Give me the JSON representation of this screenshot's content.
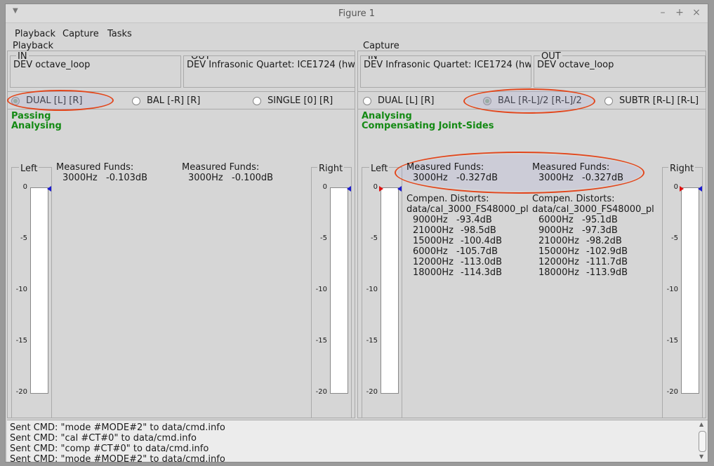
{
  "window": {
    "title": "Figure 1",
    "controls": [
      "–",
      "+",
      "×"
    ]
  },
  "menu": [
    "Playback",
    "Capture",
    "Tasks"
  ],
  "playback": {
    "title": "Playback",
    "in_label": "IN",
    "in_device": "DEV octave_loop",
    "out_label": "OUT",
    "out_device": "DEV Infrasonic Quartet: ICE1724 (hw:",
    "radios": [
      "DUAL [L] [R]",
      "BAL [-R] [R]",
      "SINGLE [0] [R]"
    ],
    "status": [
      "Passing",
      "Analysing"
    ],
    "left_label": "Left",
    "right_label": "Right",
    "funds_left": {
      "title": "Measured Funds:",
      "freq": "3000Hz",
      "value": "-0.103dB"
    },
    "funds_right": {
      "title": "Measured Funds:",
      "freq": "3000Hz",
      "value": "-0.100dB"
    }
  },
  "capture": {
    "title": "Capture",
    "in_label": "IN",
    "in_device": "DEV Infrasonic Quartet: ICE1724 (hw:",
    "out_label": "OUT",
    "out_device": "DEV octave_loop",
    "radios": [
      "DUAL [L] [R]",
      "BAL [R-L]/2 [R-L]/2",
      "SUBTR [R-L] [R-L]"
    ],
    "status": [
      "Analysing",
      "Compensating Joint-Sides"
    ],
    "left_label": "Left",
    "right_label": "Right",
    "funds_left": {
      "title": "Measured Funds:",
      "freq": "3000Hz",
      "value": "-0.327dB"
    },
    "funds_right": {
      "title": "Measured Funds:",
      "freq": "3000Hz",
      "value": "-0.327dB"
    },
    "distorts_left": {
      "title": "Compen. Distorts:",
      "file": "data/cal_3000_FS48000_pl",
      "rows": [
        [
          "9000Hz",
          "-93.4dB"
        ],
        [
          "21000Hz",
          "-98.5dB"
        ],
        [
          "15000Hz",
          "-100.4dB"
        ],
        [
          "6000Hz",
          "-105.7dB"
        ],
        [
          "12000Hz",
          "-113.0dB"
        ],
        [
          "18000Hz",
          "-114.3dB"
        ]
      ]
    },
    "distorts_right": {
      "title": "Compen. Distorts:",
      "file": "data/cal_3000_FS48000_pl",
      "rows": [
        [
          "6000Hz",
          "-95.1dB"
        ],
        [
          "9000Hz",
          "-97.3dB"
        ],
        [
          "21000Hz",
          "-98.2dB"
        ],
        [
          "15000Hz",
          "-102.9dB"
        ],
        [
          "12000Hz",
          "-111.7dB"
        ],
        [
          "18000Hz",
          "-113.9dB"
        ]
      ]
    }
  },
  "meter_ticks": [
    "0",
    "-5",
    "-10",
    "-15",
    "-20"
  ],
  "console": [
    "Sent CMD: \"mode #MODE#2\" to data/cmd.info",
    "Sent CMD: \"cal #CT#0\" to data/cmd.info",
    "Sent CMD: \"comp #CT#0\" to data/cmd.info",
    "Sent CMD: \"mode #MODE#2\" to data/cmd.info"
  ],
  "colors": {
    "status_green": "#148a14",
    "highlight": "#e2461c",
    "marker_blue": "#1b1bd0",
    "marker_red": "#e01010"
  }
}
